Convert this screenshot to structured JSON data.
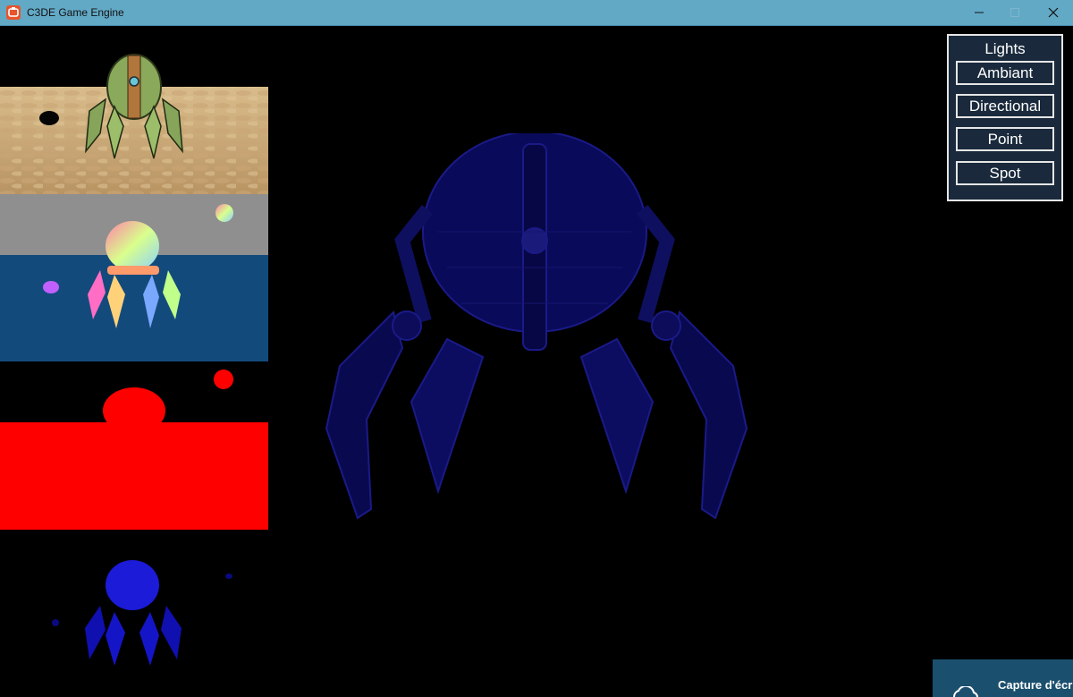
{
  "window": {
    "title": "C3DE Game Engine",
    "controls": {
      "minimize_icon": "minimize-icon",
      "maximize_icon": "maximize-icon",
      "close_icon": "close-icon"
    }
  },
  "lights_panel": {
    "title": "Lights",
    "buttons": [
      "Ambiant",
      "Directional",
      "Point",
      "Spot"
    ]
  },
  "gbuffer_previews": [
    "albedo",
    "normal",
    "depth",
    "lighting"
  ],
  "toast": {
    "text": "Capture d'écr",
    "icon": "cloud-icon"
  },
  "colors": {
    "titlebar": "#62a9c6",
    "panel_bg": "#1a2a3c",
    "normal_bg_top": "#8f8f8f",
    "normal_bg_bottom": "#134a7c",
    "depth_red": "#ff0000",
    "light_blue": "#1515d0"
  }
}
